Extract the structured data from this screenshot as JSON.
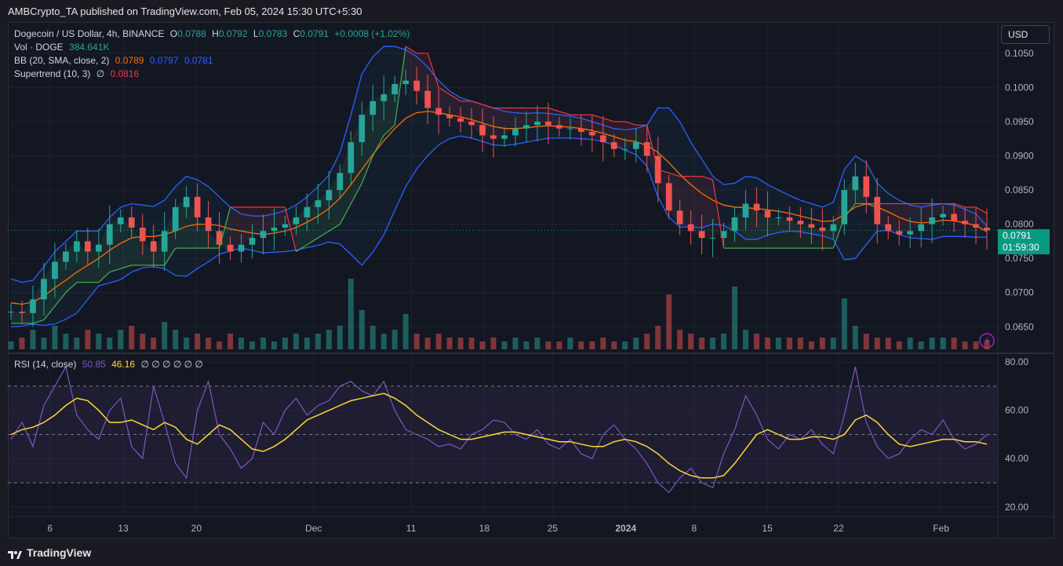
{
  "publisher": "AMBCrypto_TA published on TradingView.com, Feb 05, 2024 15:30 UTC+5:30",
  "brand": "TradingView",
  "currency_button": "USD",
  "legend": {
    "symbol": "Dogecoin / US Dollar, 4h, BINANCE",
    "o_label": "O",
    "o_value": "0.0788",
    "h_label": "H",
    "h_value": "0.0792",
    "l_label": "L",
    "l_value": "0.0783",
    "c_label": "C",
    "c_value": "0.0791",
    "change": "+0.0008 (+1.02%)",
    "vol_label": "Vol · DOGE",
    "vol_value": "384.641K",
    "bb_label": "BB (20, SMA, close, 2)",
    "bb_mid": "0.0789",
    "bb_upper": "0.0797",
    "bb_lower": "0.0781",
    "st_label": "Supertrend (10, 3)",
    "st_symbol": "∅",
    "st_value": "0.0816",
    "rsi_label": "RSI (14, close)",
    "rsi_value": "50.85",
    "rsi_ma": "46.16",
    "rsi_empty": "∅ ∅ ∅ ∅ ∅ ∅"
  },
  "price_tag": {
    "price": "0.0791",
    "countdown": "01:59:30"
  },
  "colors": {
    "up": "#26a69a",
    "down": "#ef5350",
    "bb_basis": "#ff6d00",
    "bb_band": "#2962ff",
    "st_up": "#4caf50",
    "st_down": "#f23645",
    "rsi": "#7e57c2",
    "rsi_ma": "#fdd835",
    "tag": "#089981"
  },
  "chart_data": [
    {
      "type": "line",
      "title": "Dogecoin / US Dollar, 4h, BINANCE",
      "y_ticks": [
        "0.1050",
        "0.1000",
        "0.0950",
        "0.0900",
        "0.0850",
        "0.0800",
        "0.0750",
        "0.0700",
        "0.0650"
      ],
      "ylim": [
        0.0617,
        0.1082
      ],
      "x_ticks": [
        "6",
        "13",
        "20",
        "Dec",
        "11",
        "18",
        "25",
        "2024",
        "8",
        "15",
        "22",
        "Feb"
      ],
      "series": [
        {
          "name": "Close",
          "values": [
            0.0672,
            0.067,
            0.069,
            0.072,
            0.0745,
            0.076,
            0.0775,
            0.076,
            0.077,
            0.08,
            0.081,
            0.0795,
            0.0775,
            0.076,
            0.079,
            0.0825,
            0.084,
            0.081,
            0.079,
            0.077,
            0.076,
            0.077,
            0.078,
            0.079,
            0.0795,
            0.08,
            0.081,
            0.0825,
            0.0835,
            0.085,
            0.0875,
            0.092,
            0.096,
            0.098,
            0.099,
            0.1005,
            0.101,
            0.0995,
            0.097,
            0.096,
            0.0955,
            0.095,
            0.0945,
            0.093,
            0.0925,
            0.093,
            0.094,
            0.0945,
            0.095,
            0.0945,
            0.094,
            0.094,
            0.0935,
            0.093,
            0.092,
            0.091,
            0.091,
            0.092,
            0.09,
            0.086,
            0.082,
            0.08,
            0.079,
            0.078,
            0.078,
            0.079,
            0.081,
            0.083,
            0.082,
            0.081,
            0.081,
            0.0805,
            0.08,
            0.0795,
            0.079,
            0.08,
            0.085,
            0.087,
            0.084,
            0.08,
            0.079,
            0.0785,
            0.079,
            0.08,
            0.081,
            0.0815,
            0.0805,
            0.08,
            0.0795,
            0.0791
          ]
        },
        {
          "name": "BB Basis",
          "values": [
            0.0685,
            0.0683,
            0.0686,
            0.0695,
            0.0707,
            0.0718,
            0.073,
            0.074,
            0.075,
            0.0762,
            0.0772,
            0.078,
            0.0782,
            0.0782,
            0.0785,
            0.079,
            0.0797,
            0.08,
            0.08,
            0.0798,
            0.0793,
            0.079,
            0.0787,
            0.0785,
            0.0787,
            0.079,
            0.0795,
            0.0803,
            0.0812,
            0.0823,
            0.0838,
            0.0858,
            0.088,
            0.0902,
            0.0922,
            0.094,
            0.0955,
            0.0963,
            0.0965,
            0.0963,
            0.096,
            0.0957,
            0.0953,
            0.0948,
            0.0943,
            0.094,
            0.094,
            0.0941,
            0.0943,
            0.0944,
            0.0943,
            0.0942,
            0.094,
            0.0937,
            0.0933,
            0.0928,
            0.0923,
            0.0921,
            0.0915,
            0.0905,
            0.089,
            0.0873,
            0.0858,
            0.0845,
            0.0835,
            0.0828,
            0.0825,
            0.0824,
            0.0823,
            0.0821,
            0.0819,
            0.0816,
            0.0812,
            0.0808,
            0.0804,
            0.0805,
            0.0814,
            0.0825,
            0.083,
            0.0825,
            0.0818,
            0.081,
            0.0804,
            0.0802,
            0.0803,
            0.0806,
            0.0805,
            0.0802,
            0.0798,
            0.0789
          ]
        },
        {
          "name": "BB Upper",
          "values": [
            0.072,
            0.0715,
            0.0718,
            0.0738,
            0.076,
            0.0775,
            0.079,
            0.079,
            0.079,
            0.081,
            0.0825,
            0.083,
            0.0828,
            0.0826,
            0.0835,
            0.0855,
            0.087,
            0.0865,
            0.0855,
            0.084,
            0.0825,
            0.0815,
            0.0812,
            0.0812,
            0.0815,
            0.082,
            0.0828,
            0.084,
            0.0855,
            0.0872,
            0.0905,
            0.096,
            0.102,
            0.1045,
            0.106,
            0.106,
            0.1055,
            0.1045,
            0.103,
            0.101,
            0.0995,
            0.0985,
            0.098,
            0.0975,
            0.097,
            0.0965,
            0.0963,
            0.0962,
            0.0963,
            0.0962,
            0.096,
            0.0958,
            0.0955,
            0.095,
            0.0945,
            0.094,
            0.0938,
            0.094,
            0.0945,
            0.097,
            0.097,
            0.095,
            0.092,
            0.0895,
            0.087,
            0.0858,
            0.086,
            0.087,
            0.0868,
            0.0858,
            0.085,
            0.0842,
            0.0835,
            0.083,
            0.0825,
            0.0832,
            0.088,
            0.09,
            0.089,
            0.086,
            0.0845,
            0.0835,
            0.0828,
            0.0825,
            0.0828,
            0.083,
            0.0828,
            0.0822,
            0.0815,
            0.0797
          ]
        },
        {
          "name": "BB Lower",
          "values": [
            0.065,
            0.0651,
            0.0654,
            0.0652,
            0.0654,
            0.0661,
            0.067,
            0.069,
            0.071,
            0.0714,
            0.0719,
            0.073,
            0.0736,
            0.0738,
            0.0735,
            0.0725,
            0.0724,
            0.0735,
            0.0745,
            0.0756,
            0.0761,
            0.0765,
            0.0762,
            0.0758,
            0.0759,
            0.076,
            0.0762,
            0.0766,
            0.0769,
            0.0774,
            0.0771,
            0.0756,
            0.074,
            0.0759,
            0.0784,
            0.082,
            0.0855,
            0.0881,
            0.09,
            0.0916,
            0.0925,
            0.0929,
            0.0926,
            0.0921,
            0.0916,
            0.0915,
            0.0917,
            0.092,
            0.0923,
            0.0926,
            0.0926,
            0.0926,
            0.0925,
            0.0924,
            0.0921,
            0.0916,
            0.0908,
            0.0902,
            0.0885,
            0.084,
            0.081,
            0.0796,
            0.0796,
            0.0795,
            0.08,
            0.0798,
            0.079,
            0.0778,
            0.0778,
            0.0784,
            0.0788,
            0.079,
            0.0789,
            0.0786,
            0.0783,
            0.0778,
            0.0748,
            0.075,
            0.077,
            0.079,
            0.0791,
            0.0785,
            0.078,
            0.0779,
            0.0778,
            0.0782,
            0.0782,
            0.0782,
            0.0781,
            0.0781
          ]
        },
        {
          "name": "Supertrend",
          "values": [
            0.0655,
            0.0655,
            0.0655,
            0.066,
            0.068,
            0.07,
            0.0715,
            0.0715,
            0.0715,
            0.073,
            0.0735,
            0.074,
            0.074,
            0.074,
            0.074,
            0.0765,
            0.0765,
            0.0765,
            0.0765,
            0.0765,
            0.0825,
            0.0825,
            0.0825,
            0.0825,
            0.0825,
            0.0825,
            0.076,
            0.077,
            0.078,
            0.079,
            0.08,
            0.083,
            0.086,
            0.09,
            0.093,
            0.0945,
            0.106,
            0.105,
            0.105,
            0.1,
            0.099,
            0.098,
            0.098,
            0.0975,
            0.097,
            0.097,
            0.097,
            0.097,
            0.097,
            0.097,
            0.0965,
            0.096,
            0.096,
            0.096,
            0.0955,
            0.095,
            0.095,
            0.0945,
            0.0945,
            0.088,
            0.0875,
            0.087,
            0.087,
            0.087,
            0.0865,
            0.0765,
            0.0765,
            0.0765,
            0.0765,
            0.0765,
            0.0765,
            0.0765,
            0.0765,
            0.0765,
            0.0765,
            0.0765,
            0.081,
            0.083,
            0.083,
            0.083,
            0.083,
            0.083,
            0.083,
            0.083,
            0.083,
            0.083,
            0.083,
            0.0825,
            0.0825,
            0.0816
          ]
        }
      ]
    },
    {
      "type": "line",
      "title": "RSI (14, close)",
      "y_ticks": [
        "80.00",
        "60.00",
        "40.00",
        "20.00"
      ],
      "ylim": [
        17,
        82
      ],
      "bands": [
        30,
        50,
        70
      ],
      "series": [
        {
          "name": "RSI",
          "values": [
            48,
            55,
            45,
            62,
            70,
            78,
            58,
            52,
            48,
            60,
            65,
            45,
            40,
            70,
            55,
            38,
            32,
            60,
            72,
            50,
            44,
            36,
            40,
            55,
            50,
            60,
            65,
            58,
            62,
            64,
            70,
            72,
            68,
            66,
            72,
            60,
            52,
            50,
            48,
            45,
            46,
            44,
            50,
            52,
            56,
            55,
            50,
            48,
            52,
            46,
            44,
            48,
            42,
            40,
            50,
            54,
            48,
            44,
            38,
            30,
            26,
            32,
            36,
            30,
            28,
            42,
            52,
            66,
            58,
            48,
            44,
            50,
            48,
            52,
            46,
            42,
            58,
            78,
            55,
            45,
            40,
            42,
            48,
            52,
            50,
            56,
            48,
            44,
            46,
            50
          ]
        },
        {
          "name": "RSI MA",
          "values": [
            50,
            52,
            53,
            55,
            58,
            62,
            65,
            64,
            60,
            55,
            55,
            56,
            54,
            52,
            55,
            53,
            48,
            46,
            50,
            54,
            52,
            48,
            44,
            43,
            45,
            48,
            52,
            56,
            58,
            60,
            62,
            64,
            65,
            66,
            67,
            65,
            62,
            58,
            55,
            52,
            50,
            48,
            48,
            49,
            50,
            51,
            51,
            50,
            49,
            48,
            47,
            47,
            46,
            45,
            45,
            47,
            48,
            47,
            45,
            42,
            38,
            35,
            33,
            32,
            32,
            33,
            38,
            44,
            50,
            52,
            50,
            48,
            48,
            49,
            49,
            48,
            50,
            56,
            58,
            55,
            50,
            46,
            45,
            46,
            47,
            48,
            48,
            47,
            47,
            46
          ]
        }
      ]
    },
    {
      "type": "bar",
      "title": "Vol · DOGE",
      "values": [
        0.2,
        0.3,
        0.5,
        0.3,
        0.6,
        0.4,
        0.3,
        0.5,
        0.4,
        0.3,
        0.5,
        0.6,
        0.4,
        0.3,
        0.7,
        0.5,
        0.3,
        0.4,
        0.3,
        0.2,
        0.4,
        0.3,
        0.2,
        0.3,
        0.2,
        0.3,
        0.4,
        0.3,
        0.4,
        0.5,
        0.6,
        1.8,
        1.0,
        0.6,
        0.4,
        0.5,
        0.9,
        0.4,
        0.3,
        0.4,
        0.3,
        0.3,
        0.3,
        0.2,
        0.3,
        0.2,
        0.3,
        0.2,
        0.3,
        0.2,
        0.2,
        0.3,
        0.2,
        0.2,
        0.3,
        0.2,
        0.2,
        0.3,
        0.4,
        0.6,
        1.4,
        0.5,
        0.4,
        0.3,
        0.3,
        0.4,
        1.6,
        0.5,
        0.4,
        0.3,
        0.3,
        0.3,
        0.3,
        0.2,
        0.3,
        0.3,
        1.3,
        0.6,
        0.4,
        0.3,
        0.3,
        0.2,
        0.3,
        0.2,
        0.3,
        0.3,
        0.3,
        0.2,
        0.2,
        0.2
      ]
    }
  ]
}
